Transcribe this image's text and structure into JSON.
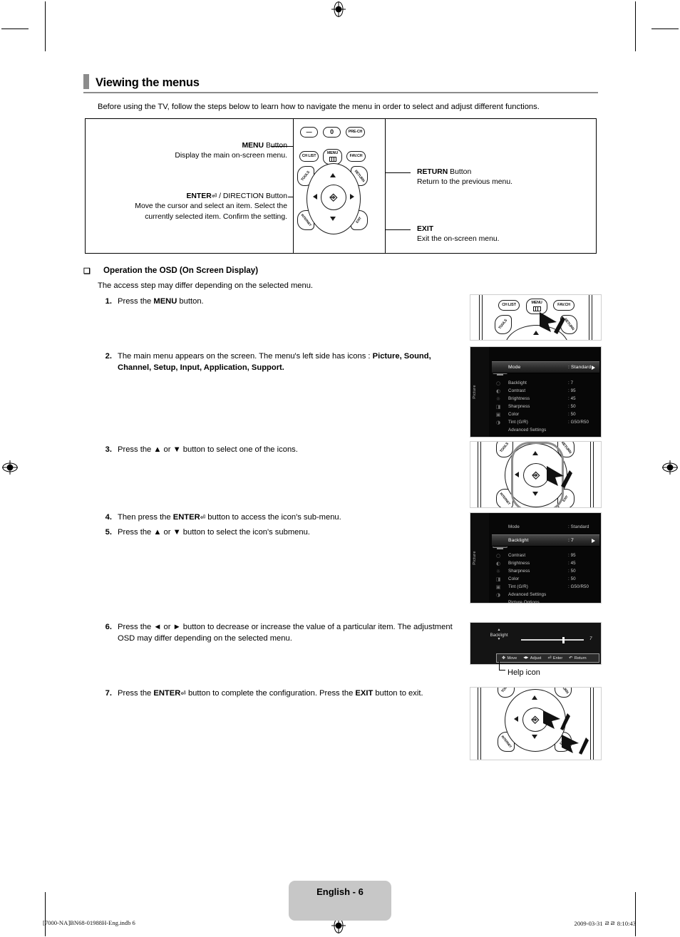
{
  "header": {
    "title": "Viewing the menus",
    "intro": "Before using the TV, follow the steps below to learn how to navigate the menu in order to select and adjust different functions."
  },
  "diagram": {
    "callouts": {
      "menu_title_bold": "MENU",
      "menu_title_rest": " Button",
      "menu_desc": "Display the main on-screen menu.",
      "enter_title_bold": "ENTER",
      "enter_title_rest": " / DIRECTION Button",
      "enter_desc": "Move the cursor and select an item. Select the currently selected item. Confirm the setting.",
      "return_title_bold": "RETURN",
      "return_title_rest": " Button",
      "return_desc": "Return to the previous menu.",
      "exit_title_bold": "EXIT",
      "exit_desc": "Exit the on-screen menu."
    },
    "remote_buttons": {
      "minus": "—",
      "zero": "0",
      "pre_ch": "PRE-CH",
      "ch_list": "CH LIST",
      "menu": "MENU",
      "fav_ch": "FAV.CH",
      "tools": "TOOLS",
      "return": "RETURN",
      "internet": "INTERNET",
      "exit": "EXIT"
    }
  },
  "osd_section": {
    "bullet": "❑",
    "title": "Operation the OSD (On Screen Display)",
    "subtitle": "The access step may differ depending on the selected menu.",
    "steps": [
      {
        "num": "1.",
        "parts": [
          {
            "t": "Press the ",
            "b": false
          },
          {
            "t": "MENU",
            "b": true
          },
          {
            "t": " button.",
            "b": false
          }
        ]
      },
      {
        "num": "2.",
        "parts": [
          {
            "t": "The main menu appears on the screen. The menu's left side has icons : ",
            "b": false
          },
          {
            "t": "Picture, Sound, Channel, Setup, Input, Application, Support.",
            "b": true
          }
        ]
      },
      {
        "num": "3.",
        "parts": [
          {
            "t": "Press the ▲ or ▼ button to select one of the icons.",
            "b": false
          }
        ]
      },
      {
        "num": "4.",
        "parts": [
          {
            "t": "Then press the ",
            "b": false
          },
          {
            "t": "ENTER",
            "b": true
          },
          {
            "t": "⏎",
            "b": false
          },
          {
            "t": " button to access the icon's sub-menu.",
            "b": false
          }
        ]
      },
      {
        "num": "5.",
        "parts": [
          {
            "t": "Press the ▲ or ▼ button to select the icon's submenu.",
            "b": false
          }
        ]
      },
      {
        "num": "6.",
        "parts": [
          {
            "t": "Press the ◄ or ► button to decrease or increase the value of a particular item. The adjustment OSD may differ depending on the selected menu.",
            "b": false
          }
        ]
      },
      {
        "num": "7.",
        "parts": [
          {
            "t": "Press the ",
            "b": false
          },
          {
            "t": "ENTER",
            "b": true
          },
          {
            "t": "⏎",
            "b": false
          },
          {
            "t": " button to complete the configuration. Press the ",
            "b": false
          },
          {
            "t": "EXIT",
            "b": true
          },
          {
            "t": " button to exit.",
            "b": false
          }
        ]
      }
    ]
  },
  "osd_menu_1": {
    "side_label": "Picture",
    "highlight": {
      "key": "Mode",
      "value": ": Standard"
    },
    "rows": [
      {
        "key": "Backlight",
        "value": ": 7"
      },
      {
        "key": "Contrast",
        "value": ": 95"
      },
      {
        "key": "Brightness",
        "value": ": 45"
      },
      {
        "key": "Sharpness",
        "value": ": 50"
      },
      {
        "key": "Color",
        "value": ": 50"
      },
      {
        "key": "Tint (G/R)",
        "value": ": G50/R50"
      },
      {
        "key": "Advanced Settings",
        "value": ""
      }
    ]
  },
  "osd_menu_2": {
    "side_label": "Picture",
    "top_row": {
      "key": "Mode",
      "value": ": Standard"
    },
    "highlight": {
      "key": "Backlight",
      "value": ": 7"
    },
    "rows": [
      {
        "key": "Contrast",
        "value": ": 95"
      },
      {
        "key": "Brightness",
        "value": ": 45"
      },
      {
        "key": "Sharpness",
        "value": ": 50"
      },
      {
        "key": "Color",
        "value": ": 50"
      },
      {
        "key": "Tint (G/R)",
        "value": ": G50/R50"
      },
      {
        "key": "Advanced Settings",
        "value": ""
      },
      {
        "key": "Picture Options",
        "value": ""
      }
    ]
  },
  "osd_slider": {
    "up_arrow": "▲",
    "label": "Backlight",
    "down_arrow": "▼",
    "value": "7",
    "help_items": [
      {
        "glyph": "✥",
        "label": "Move"
      },
      {
        "glyph": "◀▶",
        "label": "Adjust"
      },
      {
        "glyph": "⏎",
        "label": "Enter"
      },
      {
        "glyph": "↶",
        "label": "Return"
      }
    ],
    "help_caption": "Help icon"
  },
  "footer": {
    "page_label": "English - 6",
    "left": "[7000-NA]BN68-01988H-Eng.indb   6",
    "right": "2009-03-31   ㄹㄹ 8:10:43"
  }
}
